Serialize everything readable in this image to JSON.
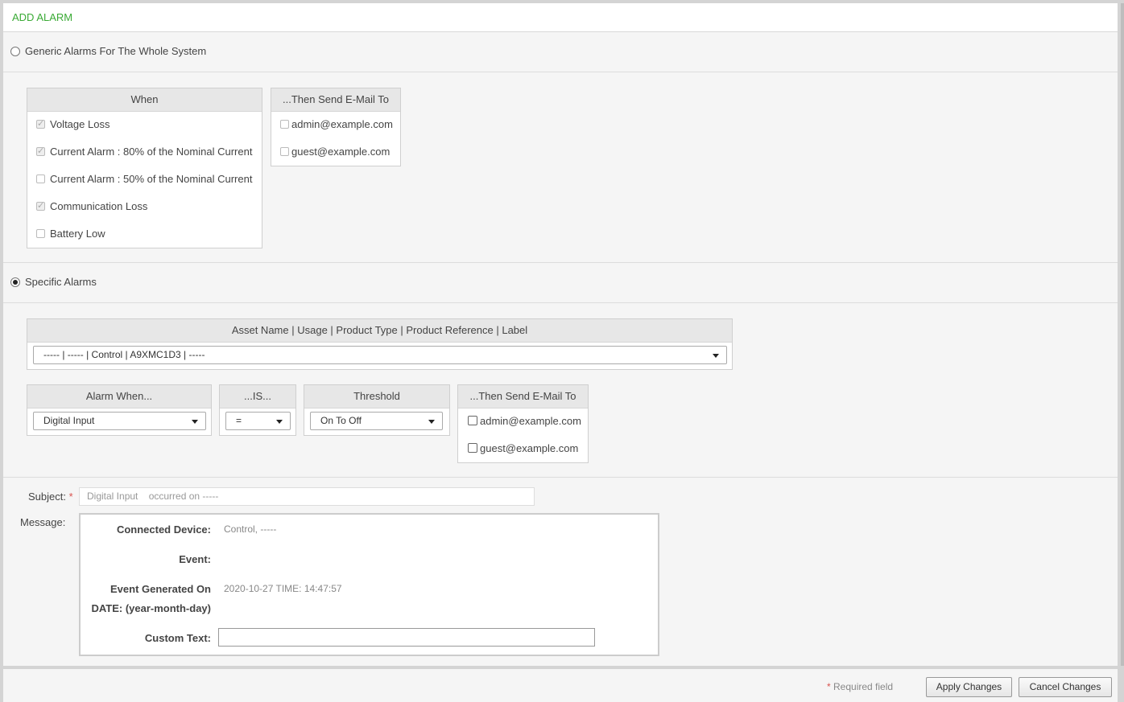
{
  "title": "ADD ALARM",
  "generic": {
    "radio_label": "Generic Alarms For The Whole System",
    "when_header": "When",
    "email_header": "...Then Send E-Mail To",
    "conditions": [
      {
        "label": "Voltage Loss",
        "checked": true
      },
      {
        "label": "Current Alarm : 80% of the Nominal Current",
        "checked": true
      },
      {
        "label": "Current Alarm : 50% of the Nominal Current",
        "checked": false
      },
      {
        "label": "Communication Loss",
        "checked": true
      },
      {
        "label": "Battery Low",
        "checked": false
      }
    ],
    "emails": [
      {
        "label": "admin@example.com",
        "checked": false
      },
      {
        "label": "guest@example.com",
        "checked": false
      }
    ]
  },
  "specific": {
    "radio_label": "Specific Alarms",
    "asset_header": "Asset Name | Usage | Product Type | Product Reference | Label",
    "asset_value": "----- | ----- | Control | A9XMC1D3 | -----",
    "alarm_when_header": "Alarm When...",
    "alarm_when_value": "Digital Input",
    "is_header": "...IS...",
    "is_value": "=",
    "threshold_header": "Threshold",
    "threshold_value": "On To Off",
    "email_header": "...Then Send E-Mail To",
    "emails": [
      {
        "label": "admin@example.com",
        "checked": false
      },
      {
        "label": "guest@example.com",
        "checked": false
      }
    ]
  },
  "subject": {
    "label": "Subject:",
    "required_mark": "*",
    "value": "Digital Input    occurred on -----"
  },
  "message": {
    "label": "Message:",
    "connected_device_label": "Connected Device:",
    "connected_device_value": "Control, -----",
    "event_label": "Event:",
    "event_generated_label_1": "Event Generated On",
    "event_generated_label_2": "DATE: (year-month-day)",
    "event_generated_value": "2020-10-27 TIME: 14:47:57",
    "custom_text_label": "Custom Text:",
    "custom_text_value": ""
  },
  "footer": {
    "required_mark": "*",
    "required_note": "Required field",
    "apply_label": "Apply Changes",
    "cancel_label": "Cancel Changes"
  },
  "colors": {
    "title": "#3aaa35",
    "required": "#d9534f"
  }
}
